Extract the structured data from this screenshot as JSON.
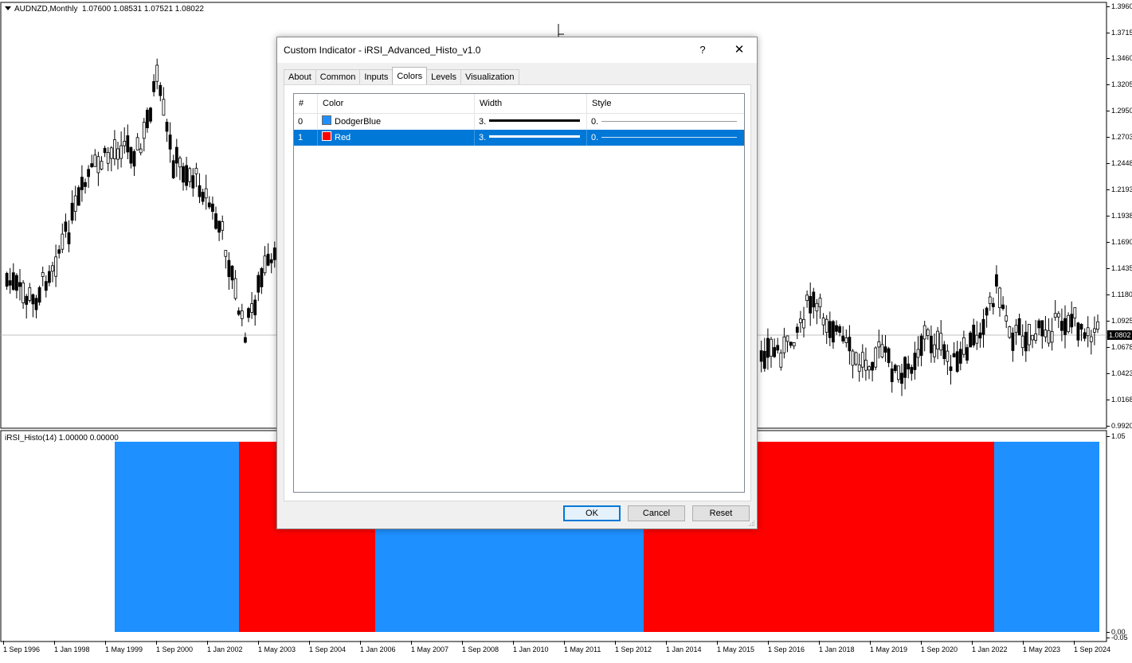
{
  "chart": {
    "symbol_title": "AUDNZD,Monthly  1.07600 1.08531 1.07521 1.08022",
    "indicator_title": "iRSI_Histo(14) 1.00000 0.00000",
    "current_price": "1.0802",
    "price_labels": [
      "1.3960",
      "1.3715",
      "1.3460",
      "1.3205",
      "1.2950",
      "1.2703",
      "1.2448",
      "1.2193",
      "1.1938",
      "1.1690",
      "1.1435",
      "1.1180",
      "1.0925",
      "1.0678",
      "1.0423",
      "1.0168",
      "0.9920"
    ],
    "indicator_labels": [
      "1.05",
      "0.00",
      "-0.05"
    ],
    "time_labels": [
      "1 Sep 1996",
      "1 Jan 1998",
      "1 May 1999",
      "1 Sep 2000",
      "1 Jan 2002",
      "1 May 2003",
      "1 Sep 2004",
      "1 Jan 2006",
      "1 May 2007",
      "1 Sep 2008",
      "1 Jan 2010",
      "1 May 2011",
      "1 Sep 2012",
      "1 Jan 2014",
      "1 May 2015",
      "1 Sep 2016",
      "1 Jan 2018",
      "1 May 2019",
      "1 Sep 2020",
      "1 Jan 2022",
      "1 May 2023",
      "1 Sep 2024"
    ],
    "colors": {
      "blue": "#1e90ff",
      "red": "#ff0000"
    },
    "histogram": [
      {
        "color": "blue",
        "value": 1
      },
      {
        "color": "red",
        "value": 1
      },
      {
        "color": "blue",
        "value": 1
      },
      {
        "color": "red",
        "value": 1
      },
      {
        "color": "blue",
        "value": 1
      }
    ]
  },
  "dialog": {
    "title": "Custom Indicator - iRSI_Advanced_Histo_v1.0",
    "help_label": "?",
    "close_label": "✕",
    "tabs": [
      {
        "label": "About"
      },
      {
        "label": "Common"
      },
      {
        "label": "Inputs"
      },
      {
        "label": "Colors",
        "active": true
      },
      {
        "label": "Levels"
      },
      {
        "label": "Visualization"
      }
    ],
    "grid": {
      "headers": [
        "#",
        "Color",
        "Width",
        "Style"
      ],
      "rows": [
        {
          "index": "0",
          "color_name": "DodgerBlue",
          "swatch": "#1e90ff",
          "width": "3.",
          "style": "0."
        },
        {
          "index": "1",
          "color_name": "Red",
          "swatch": "#ff0000",
          "width": "3.",
          "style": "0.",
          "selected": true
        }
      ]
    },
    "buttons": {
      "ok": "OK",
      "cancel": "Cancel",
      "reset": "Reset"
    }
  }
}
